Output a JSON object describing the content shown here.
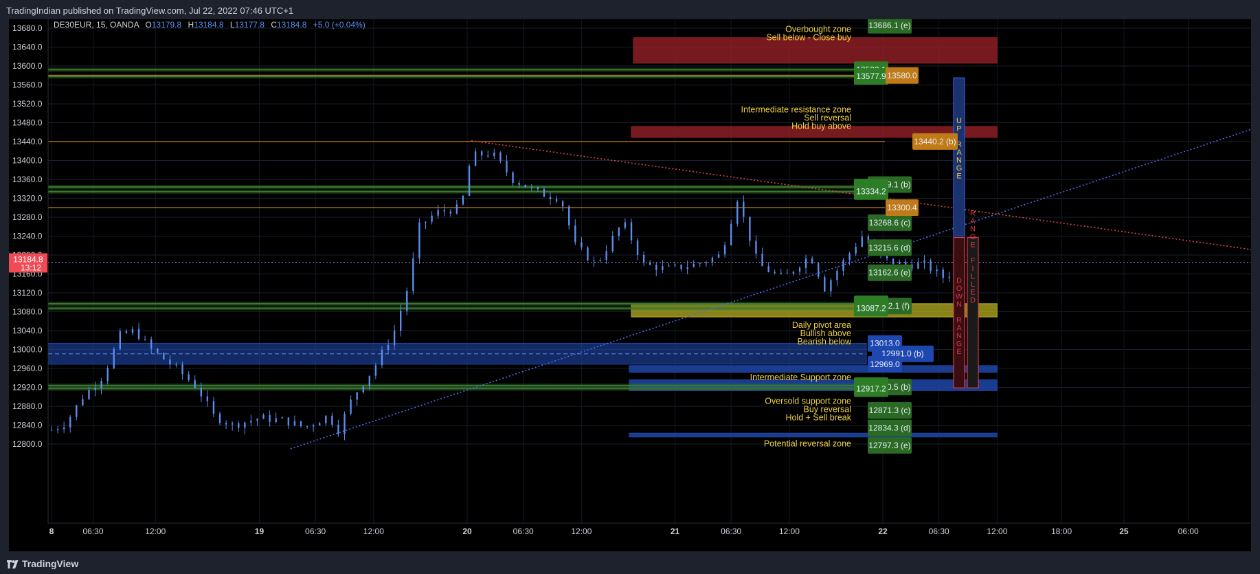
{
  "header": {
    "publish_line": "TradingIndian published on TradingView.com, Jul 22, 2022 07:46 UTC+1"
  },
  "footer": {
    "brand": "TradingView"
  },
  "legend": {
    "symbol": "DE30EUR, 15, OANDA",
    "o_label": "O",
    "o_value": "13179.8",
    "h_label": "H",
    "h_value": "13184.8",
    "l_label": "L",
    "l_value": "13177.8",
    "c_label": "C",
    "c_value": "13184.8",
    "change": "+5.0 (+0.04%)"
  },
  "colors": {
    "background": "#000000",
    "candle": "#5b8def",
    "support": "#3a7a2e",
    "resistance_zone": "#8c1f26",
    "pivot_zone": "#b5ad22",
    "blue_zone": "#1e46a8",
    "orange": "#c07a17",
    "label_yellow": "#f0d23c",
    "red_trend": "#e04545",
    "blue_trend": "#4a6cf0",
    "last_price": "#f24a55"
  },
  "chart_data": {
    "type": "candlestick",
    "symbol": "DE30EUR",
    "timeframe": "15",
    "y_ticks": [
      "13680.0",
      "13640.0",
      "13600.0",
      "13560.0",
      "13520.0",
      "13480.0",
      "13440.0",
      "13400.0",
      "13360.0",
      "13320.0",
      "13280.0",
      "13240.0",
      "13200.0",
      "13160.0",
      "13120.0",
      "13080.0",
      "13040.0",
      "13000.0",
      "12960.0",
      "12920.0",
      "12880.0",
      "12840.0",
      "12800.0"
    ],
    "ylim": [
      12784,
      13698
    ],
    "x_ticks": [
      {
        "label": "8",
        "t": 0.0,
        "bold": true
      },
      {
        "label": "06:30",
        "t": 0.2
      },
      {
        "label": "12:00",
        "t": 0.5
      },
      {
        "label": "19",
        "t": 1.0,
        "bold": true
      },
      {
        "label": "06:30",
        "t": 1.27
      },
      {
        "label": "12:00",
        "t": 1.55
      },
      {
        "label": "20",
        "t": 2.0,
        "bold": true
      },
      {
        "label": "06:30",
        "t": 2.27
      },
      {
        "label": "12:00",
        "t": 2.55
      },
      {
        "label": "21",
        "t": 3.0,
        "bold": true
      },
      {
        "label": "06:30",
        "t": 3.27
      },
      {
        "label": "12:00",
        "t": 3.55
      },
      {
        "label": "22",
        "t": 4.0,
        "bold": true
      },
      {
        "label": "06:30",
        "t": 4.27
      },
      {
        "label": "12:00",
        "t": 4.55
      },
      {
        "label": "18:00",
        "t": 4.86
      },
      {
        "label": "25",
        "t": 5.16,
        "bold": true
      },
      {
        "label": "06:00",
        "t": 5.47
      }
    ],
    "price_path": [
      [
        0.0,
        12830
      ],
      [
        0.07,
        12845
      ],
      [
        0.15,
        12900
      ],
      [
        0.25,
        12945
      ],
      [
        0.33,
        13030
      ],
      [
        0.4,
        13040
      ],
      [
        0.48,
        13000
      ],
      [
        0.6,
        12960
      ],
      [
        0.7,
        12920
      ],
      [
        0.78,
        12860
      ],
      [
        0.87,
        12840
      ],
      [
        1.0,
        12855
      ],
      [
        1.12,
        12850
      ],
      [
        1.22,
        12835
      ],
      [
        1.33,
        12860
      ],
      [
        1.38,
        12830
      ],
      [
        1.45,
        12900
      ],
      [
        1.55,
        12960
      ],
      [
        1.65,
        13040
      ],
      [
        1.72,
        13140
      ],
      [
        1.77,
        13260
      ],
      [
        1.85,
        13290
      ],
      [
        1.97,
        13300
      ],
      [
        2.02,
        13410
      ],
      [
        2.12,
        13415
      ],
      [
        2.22,
        13360
      ],
      [
        2.35,
        13330
      ],
      [
        2.45,
        13320
      ],
      [
        2.52,
        13220
      ],
      [
        2.62,
        13180
      ],
      [
        2.75,
        13270
      ],
      [
        2.85,
        13180
      ],
      [
        2.96,
        13170
      ],
      [
        3.1,
        13180
      ],
      [
        3.22,
        13200
      ],
      [
        3.3,
        13320
      ],
      [
        3.4,
        13180
      ],
      [
        3.52,
        13150
      ],
      [
        3.65,
        13200
      ],
      [
        3.72,
        13130
      ],
      [
        3.8,
        13180
      ],
      [
        3.9,
        13240
      ],
      [
        4.0,
        13190
      ],
      [
        4.1,
        13180
      ],
      [
        4.2,
        13180
      ],
      [
        4.3,
        13150
      ],
      [
        4.36,
        13180
      ]
    ],
    "levels": [
      {
        "price": 13592.1,
        "kind": "support",
        "label": "13592.1"
      },
      {
        "price": 13577.9,
        "kind": "support",
        "label": "13577.9"
      },
      {
        "price": 13344.0,
        "kind": "support",
        "label": "13344.0"
      },
      {
        "price": 13334.2,
        "kind": "support",
        "label": "13334.2"
      },
      {
        "price": 13097.0,
        "kind": "support",
        "label": "13097.0"
      },
      {
        "price": 13087.2,
        "kind": "support",
        "label": "13087.2"
      },
      {
        "price": 12923.9,
        "kind": "support",
        "label": "12923.9"
      },
      {
        "price": 12917.2,
        "kind": "support",
        "label": "12917.2"
      },
      {
        "price": 13440.2,
        "kind": "orange",
        "label": "13440.2 (b)"
      },
      {
        "price": 13300.4,
        "kind": "orange",
        "label": "13300.4"
      },
      {
        "price": 13580.0,
        "kind": "orange",
        "label": "13580.0"
      }
    ],
    "pivot_labels": [
      {
        "price": 13686.1,
        "label": "13686.1 (e)"
      },
      {
        "price": 13349.1,
        "label": "13349.1 (b)"
      },
      {
        "price": 13268.6,
        "label": "13268.6 (c)"
      },
      {
        "price": 13215.6,
        "label": "13215.6 (d)"
      },
      {
        "price": 13162.6,
        "label": "13162.6 (e)"
      },
      {
        "price": 13092.1,
        "label": "13092.1 (f)"
      },
      {
        "price": 12920.5,
        "label": "12920.5 (b)"
      },
      {
        "price": 12871.3,
        "label": "12871.3 (c)"
      },
      {
        "price": 12834.3,
        "label": "12834.3 (d)"
      },
      {
        "price": 12797.3,
        "label": "12797.3 (e)"
      }
    ],
    "blue_labels": [
      {
        "price": 13013.0,
        "label": "13013.0"
      },
      {
        "price": 12991.0,
        "label": "12991.0 (b)"
      },
      {
        "price": 12969.0,
        "label": "12969.0"
      }
    ],
    "zones": [
      {
        "kind": "resistance",
        "top": 13660,
        "bottom": 13606,
        "t0": 2.8,
        "t1": 4.55
      },
      {
        "kind": "resistance",
        "top": 13472,
        "bottom": 13449,
        "t0": 2.79,
        "t1": 4.55
      },
      {
        "kind": "pivot",
        "top": 13097,
        "bottom": 13069,
        "t0": 2.79,
        "t1": 4.55
      },
      {
        "kind": "blue_wide",
        "top": 13013,
        "bottom": 12969,
        "t0": 0.0,
        "t1": 4.6
      },
      {
        "kind": "blue",
        "top": 12966,
        "bottom": 12952,
        "t0": 2.78,
        "t1": 4.55
      },
      {
        "kind": "blue",
        "top": 12936,
        "bottom": 12913,
        "t0": 2.78,
        "t1": 4.55
      },
      {
        "kind": "blue",
        "top": 12823,
        "bottom": 12815,
        "t0": 2.78,
        "t1": 4.55
      }
    ],
    "trendlines": [
      {
        "kind": "red_trend",
        "p0": [
          2.02,
          13442
        ],
        "p1": [
          5.8,
          13210
        ]
      },
      {
        "kind": "blue_trend",
        "p0": [
          1.15,
          12790
        ],
        "p1": [
          5.8,
          13470
        ]
      }
    ],
    "zone_texts": [
      {
        "lines": [
          "Overbought zone",
          "Sell below - Close buy"
        ],
        "price": 13678
      },
      {
        "lines": [
          "Intermediate resistance zone",
          "Sell reversal",
          "Hold buy above"
        ],
        "price": 13508
      },
      {
        "lines": [
          "Daily pivot area",
          "Bullish above",
          "Bearish below"
        ],
        "price": 13052
      },
      {
        "lines": [
          "Intermediate Support zone"
        ],
        "price": 12941
      },
      {
        "lines": [
          "Oversold support zone",
          "Buy reversal",
          "Hold + Sell break"
        ],
        "price": 12891
      },
      {
        "lines": [
          "Potential reversal zone"
        ],
        "price": 12801
      }
    ],
    "range_bars": [
      {
        "text": "UP RANGE",
        "top": 13575,
        "bottom": 13240,
        "color": "#2d5bd6",
        "fill": "#1b3270"
      },
      {
        "text": "DOWN RANGE",
        "top": 13237,
        "bottom": 12919,
        "color": "#d93a45",
        "fill": "#3a0d12"
      },
      {
        "text": "RANGE FILLED",
        "top": 13237,
        "bottom": 12919,
        "color": "#d93a45",
        "fill": "#1a1a1a"
      }
    ],
    "last_price": {
      "price": 13184.8,
      "label": "13184.8",
      "timer": "13:12"
    }
  }
}
